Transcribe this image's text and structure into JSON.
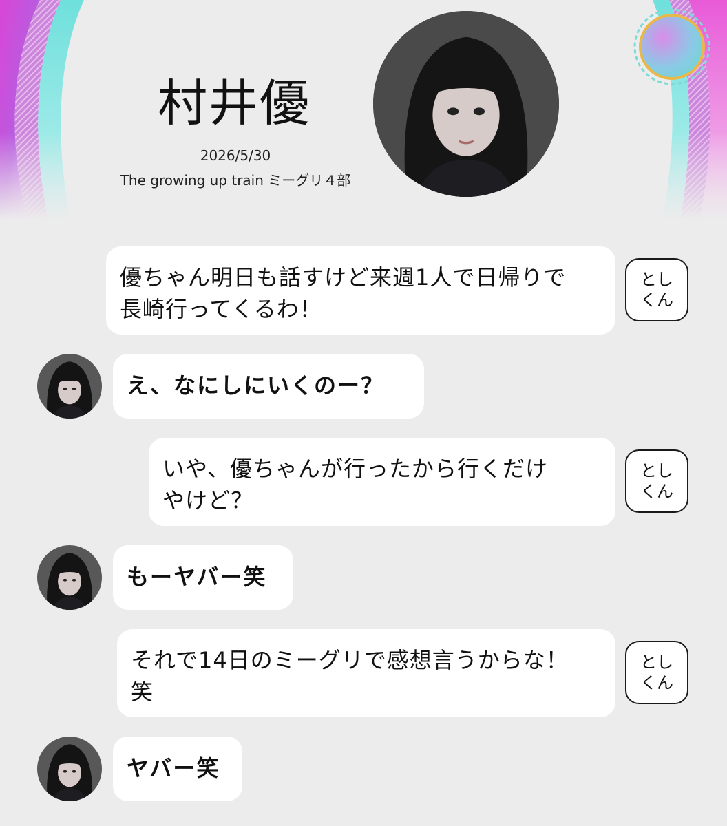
{
  "header": {
    "artist_name": "村井優",
    "event_date": "2026/5/30",
    "event_name": "The growing up train ミーグリ４部"
  },
  "messages": [
    {
      "sender": "fan",
      "tag": "とし\nくん",
      "text": "優ちゃん明日も話すけど来週1人で日帰りで\n長崎行ってくるわ！"
    },
    {
      "sender": "idol",
      "text": "え、なにしにいくのー？"
    },
    {
      "sender": "fan",
      "tag": "とし\nくん",
      "text": "いや、優ちゃんが行ったから行くだけ\nやけど？"
    },
    {
      "sender": "idol",
      "text": "もーヤバー笑"
    },
    {
      "sender": "fan",
      "tag": "とし\nくん",
      "text": "それで14日のミーグリで感想言うからな！\n笑"
    },
    {
      "sender": "idol",
      "text": "ヤバー笑"
    }
  ],
  "colors": {
    "background": "#ececec",
    "bubble": "#ffffff",
    "accent_magenta": "#e04bd8",
    "accent_teal": "#5fd3d0"
  },
  "icons": {
    "profile": "idol-portrait",
    "badge": "gradient-ring-badge",
    "avatar": "idol-avatar-icon"
  }
}
